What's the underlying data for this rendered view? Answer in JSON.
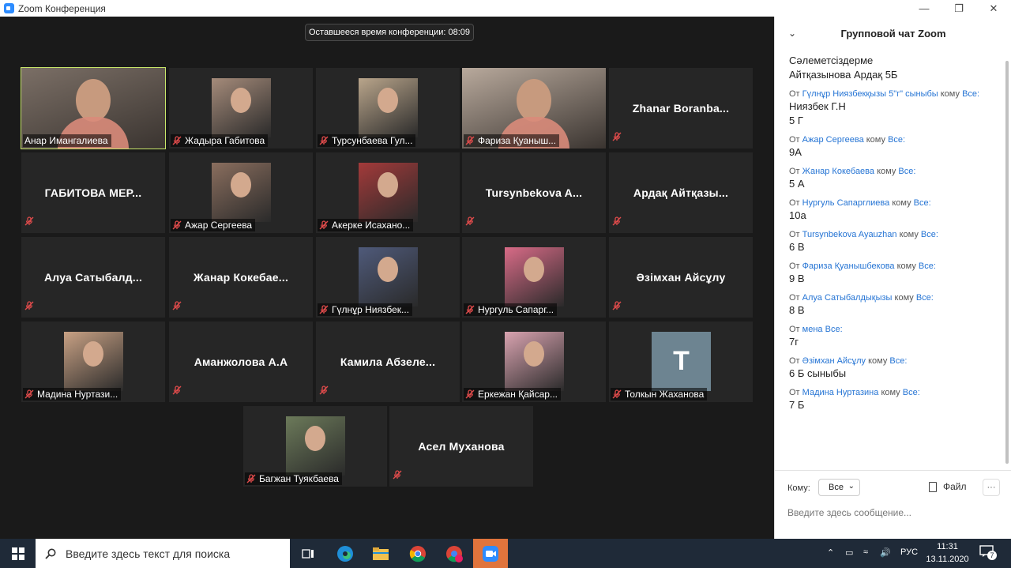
{
  "window": {
    "title": "Zoom Конференция"
  },
  "meeting": {
    "timer_text": "Оставшееся время конференции: 08:09",
    "tiles": [
      {
        "name": "Анар Имангалиева",
        "type": "video",
        "color": "#7b6f66"
      },
      {
        "name": "Жадыра Габитова",
        "type": "photo",
        "color": "#a58b7a"
      },
      {
        "name": "Турсунбаева Гул...",
        "type": "photo",
        "color": "#b9a58b"
      },
      {
        "name": "Фариза Қуаныш...",
        "type": "video",
        "color": "#b8a99c"
      },
      {
        "name": "Zhanar  Boranba...",
        "type": "text"
      },
      {
        "name": "ГАБИТОВА  МЕР...",
        "type": "text"
      },
      {
        "name": "Ажар Сергеева",
        "type": "photo",
        "color": "#8a6e5e"
      },
      {
        "name": "Акерке Исахано...",
        "type": "photo",
        "color": "#a33a3a"
      },
      {
        "name": "Tursynbekova  A...",
        "type": "text"
      },
      {
        "name": "Ардақ Айтқазы...",
        "type": "text"
      },
      {
        "name": "Алуа  Сатыбалд...",
        "type": "text"
      },
      {
        "name": "Жанар  Кокебае...",
        "type": "text"
      },
      {
        "name": "Гүлнұр Ниязбек...",
        "type": "photo",
        "color": "#4f5a7a"
      },
      {
        "name": "Нургуль Сапарг...",
        "type": "photo",
        "color": "#d86b87"
      },
      {
        "name": "Әзімхан Айсұлу",
        "type": "text"
      },
      {
        "name": "Мадина Нуртази...",
        "type": "photo",
        "color": "#c8a184"
      },
      {
        "name": "Аманжолова А.А",
        "type": "text"
      },
      {
        "name": "Камила  Абзеле...",
        "type": "text"
      },
      {
        "name": "Еркежан Қайсар...",
        "type": "photo",
        "color": "#d9a3b0"
      },
      {
        "name": "Толкын Жаханова",
        "type": "avatar",
        "initial": "T"
      },
      {
        "name": "Багжан Туякбаева",
        "type": "photo",
        "color": "#6c7a5a"
      },
      {
        "name": "Асел Муханова",
        "type": "text"
      }
    ]
  },
  "chat": {
    "title": "Групповой чат Zoom",
    "top_lines": [
      "Сәлеметсіздерме",
      "Айтқазынова Ардақ 5Б"
    ],
    "messages": [
      {
        "from_prefix": "От",
        "from": "Гүлнұр Ниязбекқызы 5\"г\" сыныбы",
        "to_prefix": "кому",
        "to": "Все:",
        "lines": [
          "Ниязбек Г.Н",
          "5 Г"
        ]
      },
      {
        "from_prefix": "От",
        "from": "Ажар Сергеева",
        "to_prefix": "кому",
        "to": "Все:",
        "lines": [
          "9А"
        ]
      },
      {
        "from_prefix": "От",
        "from": "Жанар Кокебаева",
        "to_prefix": "кому",
        "to": "Все:",
        "lines": [
          "5 А"
        ]
      },
      {
        "from_prefix": "От",
        "from": "Нургуль Сапарглиева",
        "to_prefix": "кому",
        "to": "Все:",
        "lines": [
          "10а"
        ]
      },
      {
        "from_prefix": "От",
        "from": "Tursynbekova Ayauzhan",
        "to_prefix": "кому",
        "to": "Все:",
        "lines": [
          "6 В"
        ]
      },
      {
        "from_prefix": "От",
        "from": "Фариза Қуанышбекова",
        "to_prefix": "кому",
        "to": "Все:",
        "lines": [
          "9 В"
        ]
      },
      {
        "from_prefix": "От",
        "from": "Алуа Сатыбалдықызы",
        "to_prefix": "кому",
        "to": "Все:",
        "lines": [
          "8 В"
        ]
      },
      {
        "from_prefix": "От",
        "from": "мена",
        "to_prefix": "",
        "to": "Все:",
        "lines": [
          "7г"
        ]
      },
      {
        "from_prefix": "От",
        "from": "Әзімхан Айсұлу",
        "to_prefix": "кому",
        "to": "Все:",
        "lines": [
          "6 Б сыныбы"
        ]
      },
      {
        "from_prefix": "От",
        "from": "Мадина Нуртазина",
        "to_prefix": "кому",
        "to": "Все:",
        "lines": [
          "7 Б"
        ]
      }
    ],
    "to_label": "Кому:",
    "to_value": "Все",
    "file_label": "Файл",
    "more_label": "···",
    "input_placeholder": "Введите здесь сообщение..."
  },
  "taskbar": {
    "search_placeholder": "Введите здесь текст для поиска",
    "language": "РУС",
    "time": "11:31",
    "date": "13.11.2020",
    "notification_count": "7"
  },
  "colors": {
    "active_speaker": "#c9e86a",
    "chat_link": "#2574d4",
    "taskbar": "#1f2a38",
    "zoom_active_app": "#e0743c"
  }
}
